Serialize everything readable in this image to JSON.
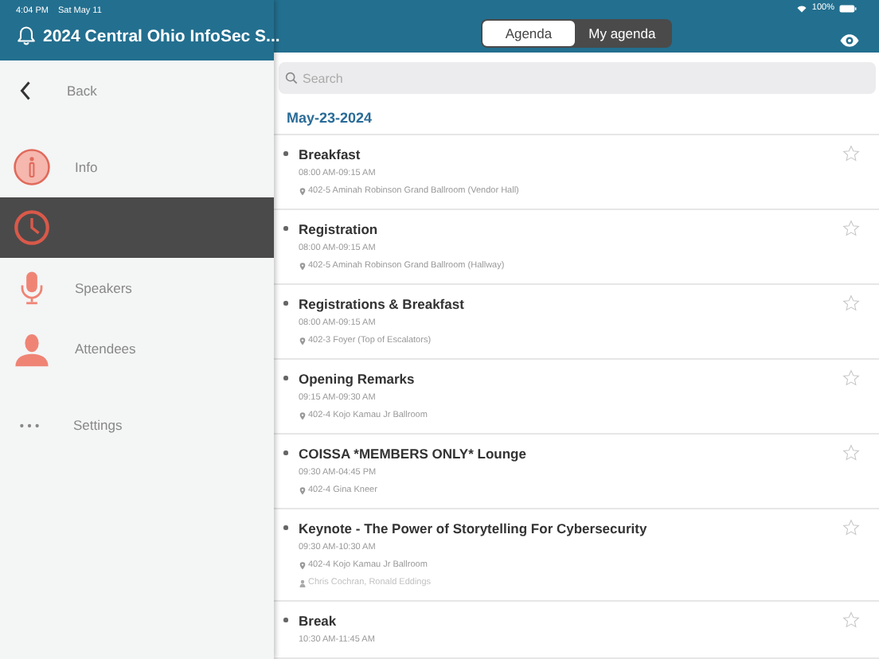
{
  "status_bar": {
    "time": "4:04 PM",
    "date": "Sat May 11",
    "battery": "100%"
  },
  "sidebar": {
    "title": "2024 Central Ohio InfoSec S...",
    "back": "Back",
    "items": [
      {
        "label": "Info",
        "selected": false
      },
      {
        "selected": true
      },
      {
        "label": "Speakers",
        "selected": false
      },
      {
        "label": "Attendees",
        "selected": false
      },
      {
        "label": "Settings",
        "selected": false
      }
    ]
  },
  "tabs": [
    {
      "label": "Agenda",
      "selected": true
    },
    {
      "label": "My agenda",
      "selected": false
    }
  ],
  "search": {
    "placeholder": "Search"
  },
  "date": "May-23-2024",
  "sessions": [
    {
      "title": "Breakfast",
      "time": "08:00 AM-09:15 AM",
      "location": "402-5 Aminah Robinson Grand Ballroom (Vendor Hall)",
      "starred": false
    },
    {
      "title": "Registration",
      "time": "08:00 AM-09:15 AM",
      "location": "402-5 Aminah Robinson Grand Ballroom (Hallway)",
      "starred": false
    },
    {
      "title": "Registrations & Breakfast",
      "time": "08:00 AM-09:15 AM",
      "location": "402-3 Foyer (Top of Escalators)",
      "starred": false
    },
    {
      "title": "Opening Remarks",
      "time": "09:15 AM-09:30 AM",
      "location": "402-4 Kojo Kamau Jr Ballroom",
      "starred": false
    },
    {
      "title": "COISSA *MEMBERS ONLY* Lounge",
      "time": "09:30 AM-04:45 PM",
      "location": "402-4 Gina Kneer",
      "starred": false
    },
    {
      "title": "Keynote - The Power of Storytelling For Cybersecurity",
      "time": "09:30 AM-10:30 AM",
      "location": "402-4 Kojo Kamau Jr Ballroom",
      "speakers": "Chris Cochran, Ronald Eddings",
      "starred": false
    },
    {
      "title": "Break",
      "time": "10:30 AM-11:45 AM",
      "starred": false
    }
  ]
}
